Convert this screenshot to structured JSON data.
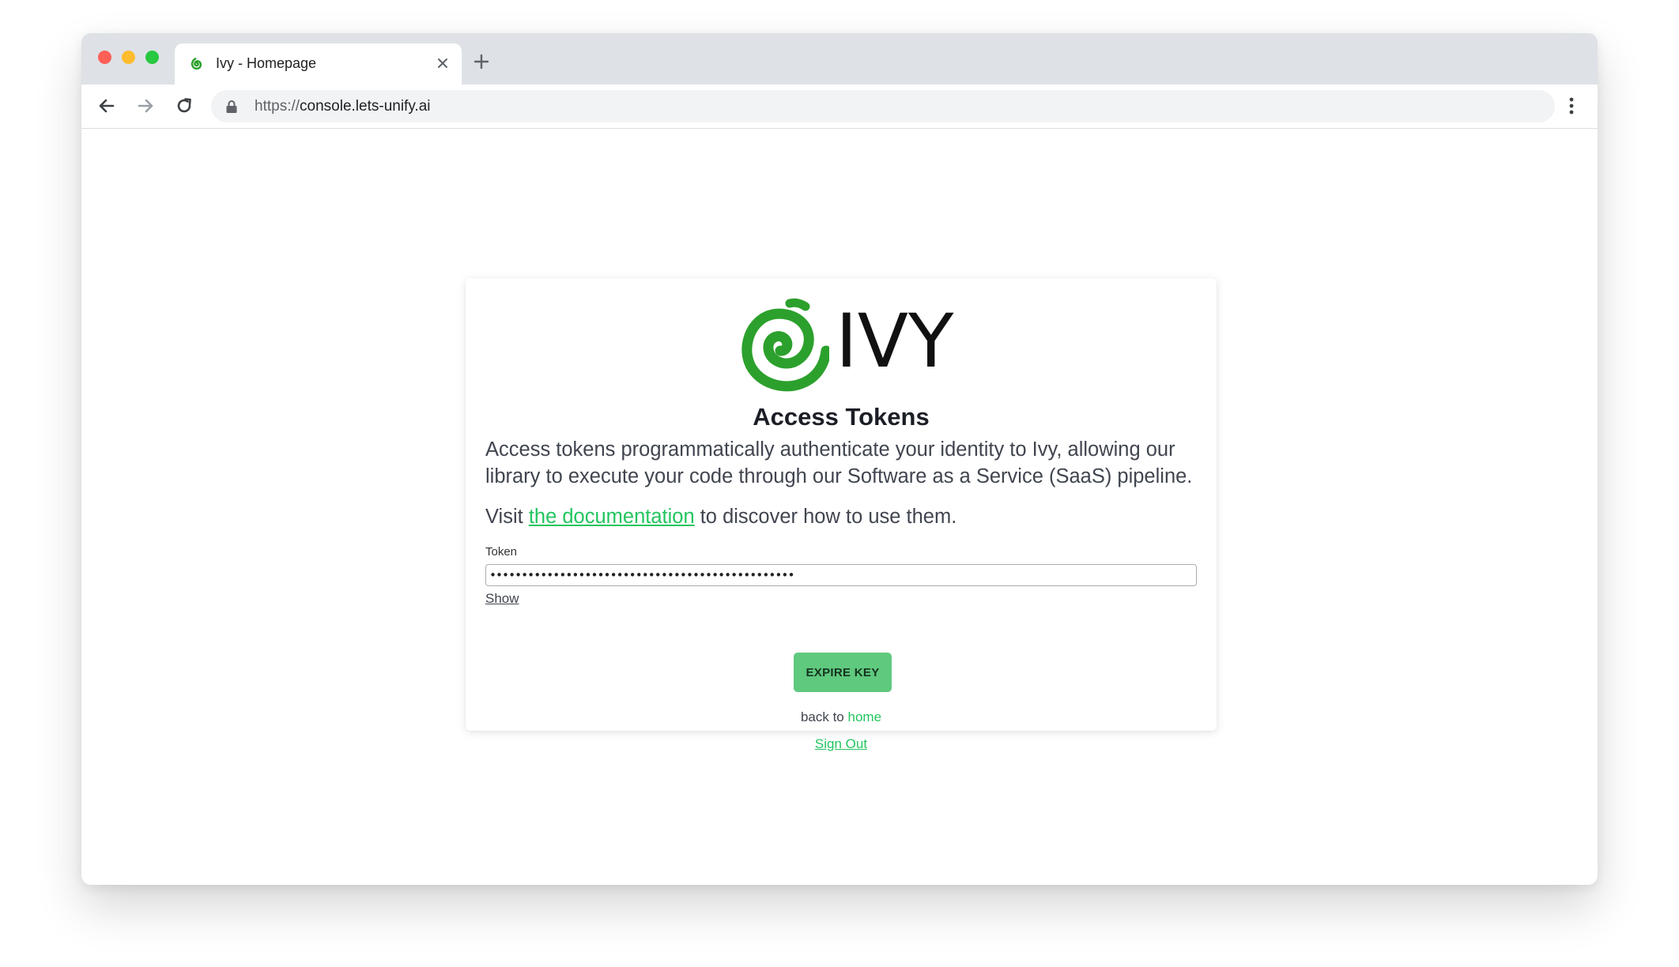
{
  "browser": {
    "tab": {
      "title": "Ivy - Homepage",
      "favicon": "ivy-spiral-icon"
    },
    "new_tab_label": "+",
    "address_bar": {
      "scheme": "https://",
      "host": "console.lets-unify.ai"
    },
    "icons": {
      "back": "arrow-left-icon",
      "forward": "arrow-right-icon",
      "reload": "reload-icon",
      "lock": "lock-icon",
      "menu": "kebab-menu-icon",
      "close": "close-icon"
    }
  },
  "page": {
    "brand": {
      "logo_text": "IVY",
      "brand_color": "#2ca02c"
    },
    "title": "Access Tokens",
    "description": "Access tokens programmatically authenticate your identity to Ivy, allowing our library to execute your code through our Software as a Service (SaaS) pipeline.",
    "visit_prefix": "Visit ",
    "doc_link_text": "the documentation",
    "visit_suffix": " to discover how to use them.",
    "token": {
      "label": "Token",
      "value": "••••••••••••••••••••••••••••••••••••••••••••••••"
    },
    "show_label": "Show",
    "expire_button_label": "EXPIRE KEY",
    "back_prefix": "back to ",
    "home_link": "home",
    "signout_label": "Sign Out",
    "accent_color": "#22c55e",
    "button_color": "#5fc97e"
  }
}
